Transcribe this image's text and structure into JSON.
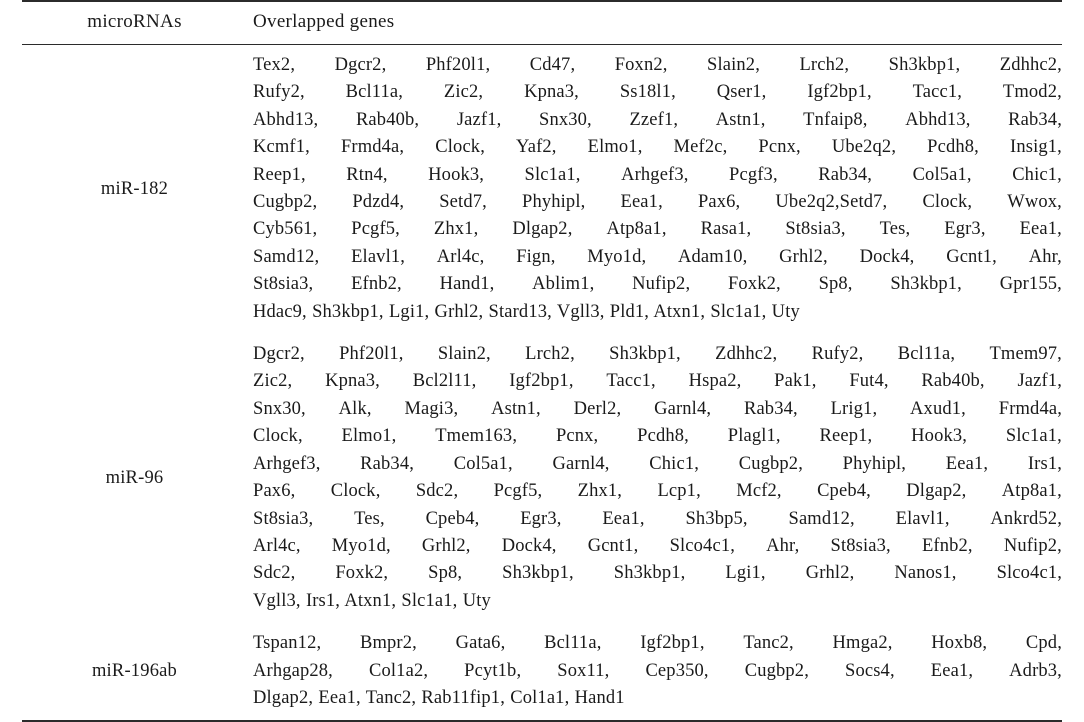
{
  "table": {
    "headers": {
      "mirna": "microRNAs",
      "genes": "Overlapped genes"
    },
    "rows": [
      {
        "mirna": "miR-182",
        "lines": [
          "Tex2, Dgcr2, Phf20l1, Cd47, Foxn2, Slain2, Lrch2, Sh3kbp1, Zdhhc2,",
          "Rufy2, Bcl11a, Zic2, Kpna3, Ss18l1, Qser1, Igf2bp1, Tacc1, Tmod2,",
          "Abhd13, Rab40b, Jazf1, Snx30, Zzef1, Astn1, Tnfaip8, Abhd13, Rab34,",
          "Kcmf1, Frmd4a, Clock, Yaf2, Elmo1, Mef2c, Pcnx, Ube2q2, Pcdh8, Insig1,",
          "Reep1, Rtn4, Hook3, Slc1a1, Arhgef3, Pcgf3, Rab34, Col5a1, Chic1,",
          "Cugbp2, Pdzd4, Setd7, Phyhipl, Eea1, Pax6, Ube2q2,Setd7, Clock, Wwox,",
          "Cyb561, Pcgf5, Zhx1, Dlgap2, Atp8a1, Rasa1, St8sia3, Tes, Egr3, Eea1,",
          "Samd12, Elavl1, Arl4c, Fign, Myo1d, Adam10, Grhl2, Dock4, Gcnt1, Ahr,",
          "St8sia3, Efnb2, Hand1, Ablim1, Nufip2, Foxk2, Sp8, Sh3kbp1, Gpr155,",
          "Hdac9, Sh3kbp1, Lgi1, Grhl2, Stard13, Vgll3, Pld1, Atxn1, Slc1a1, Uty"
        ]
      },
      {
        "mirna": "miR-96",
        "lines": [
          "Dgcr2, Phf20l1, Slain2, Lrch2, Sh3kbp1, Zdhhc2, Rufy2, Bcl11a, Tmem97,",
          "Zic2, Kpna3, Bcl2l11, Igf2bp1, Tacc1, Hspa2, Pak1, Fut4, Rab40b, Jazf1,",
          "Snx30, Alk, Magi3, Astn1, Derl2, Garnl4, Rab34, Lrig1, Axud1, Frmd4a,",
          "Clock, Elmo1, Tmem163, Pcnx, Pcdh8, Plagl1, Reep1, Hook3, Slc1a1,",
          "Arhgef3, Rab34, Col5a1, Garnl4, Chic1, Cugbp2, Phyhipl, Eea1, Irs1,",
          "Pax6, Clock, Sdc2, Pcgf5, Zhx1, Lcp1, Mcf2, Cpeb4, Dlgap2, Atp8a1,",
          "St8sia3, Tes, Cpeb4, Egr3, Eea1, Sh3bp5, Samd12, Elavl1, Ankrd52,",
          "Arl4c, Myo1d, Grhl2, Dock4, Gcnt1, Slco4c1, Ahr, St8sia3, Efnb2, Nufip2,",
          "Sdc2, Foxk2, Sp8, Sh3kbp1, Sh3kbp1, Lgi1, Grhl2, Nanos1, Slco4c1,",
          "Vgll3, Irs1, Atxn1, Slc1a1, Uty"
        ]
      },
      {
        "mirna": "miR-196ab",
        "lines": [
          "Tspan12, Bmpr2, Gata6, Bcl11a, Igf2bp1, Tanc2, Hmga2, Hoxb8, Cpd,",
          "Arhgap28, Col1a2, Pcyt1b, Sox11, Cep350, Cugbp2, Socs4, Eea1, Adrb3,",
          "Dlgap2, Eea1, Tanc2, Rab11fip1, Col1a1, Hand1"
        ]
      }
    ]
  }
}
